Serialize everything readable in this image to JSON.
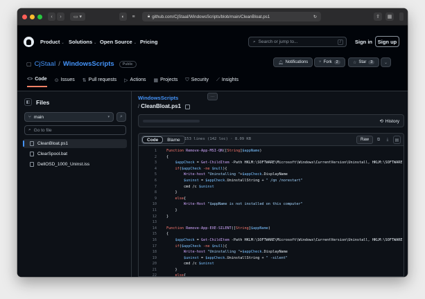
{
  "browser": {
    "url": "github.com/CjStaal/WindowsScripts/blob/main/CleanBloat.ps1"
  },
  "header": {
    "nav": [
      {
        "label": "Product"
      },
      {
        "label": "Solutions"
      },
      {
        "label": "Open Source"
      },
      {
        "label": "Pricing"
      }
    ],
    "search_placeholder": "Search or jump to...",
    "search_key": "/",
    "sign_in": "Sign in",
    "sign_up": "Sign up"
  },
  "repo": {
    "owner": "CjStaal",
    "separator": "/",
    "name": "WindowsScripts",
    "visibility": "Public",
    "notifications_label": "Notifications",
    "fork_label": "Fork",
    "fork_count": "2",
    "star_label": "Star",
    "star_count": "3",
    "tabs": [
      {
        "label": "Code",
        "icon": "<>"
      },
      {
        "label": "Issues",
        "icon": "⊙"
      },
      {
        "label": "Pull requests",
        "icon": "⇅"
      },
      {
        "label": "Actions",
        "icon": "▷"
      },
      {
        "label": "Projects",
        "icon": "▦"
      },
      {
        "label": "Security",
        "icon": "⛉"
      },
      {
        "label": "Insights",
        "icon": "⟋"
      }
    ]
  },
  "sidebar": {
    "title": "Files",
    "branch": "main",
    "goto_placeholder": "Go to file",
    "files": [
      {
        "name": "CleanBloat.ps1",
        "active": true
      },
      {
        "name": "ClearSpool.bat",
        "active": false
      },
      {
        "name": "DellOSD_1000_Uninst.iss",
        "active": false
      }
    ]
  },
  "main": {
    "breadcrumb_repo": "WindowsScripts",
    "breadcrumb_sep": "/",
    "breadcrumb_file": "CleanBloat.ps1",
    "more_label": "···",
    "history_label": "History",
    "code_tab": "Code",
    "blame_tab": "Blame",
    "file_info": "153 lines (142 loc) · 8.09 KB",
    "raw_label": "Raw"
  },
  "code_lines": [
    {
      "n": "1",
      "parts": [
        [
          "kw",
          "Function "
        ],
        [
          "fn",
          "Remove-App-MSI-QN"
        ],
        [
          "pl",
          "(["
        ],
        [
          "kw",
          "String"
        ],
        [
          "pl",
          "]"
        ],
        [
          "var",
          "$appName"
        ],
        [
          "pl",
          ")"
        ]
      ]
    },
    {
      "n": "2",
      "parts": [
        [
          "pl",
          "{"
        ]
      ]
    },
    {
      "n": "3",
      "parts": [
        [
          "pl",
          "    "
        ],
        [
          "var",
          "$appCheck"
        ],
        [
          "pl",
          " = "
        ],
        [
          "fn",
          "Get-ChildItem"
        ],
        [
          "pl",
          " -Path HKLM:\\SOFTWARE\\Microsoft\\Windows\\CurrentVersion\\Uninstall, HKLM:\\SOFTWARE"
        ]
      ]
    },
    {
      "n": "4",
      "parts": [
        [
          "pl",
          "    "
        ],
        [
          "kw",
          "if"
        ],
        [
          "pl",
          "("
        ],
        [
          "var",
          "$appCheck"
        ],
        [
          "kw",
          " -ne "
        ],
        [
          "var",
          "$null"
        ],
        [
          "pl",
          "){"
        ]
      ]
    },
    {
      "n": "5",
      "parts": [
        [
          "pl",
          "        "
        ],
        [
          "fn",
          "Write-host"
        ],
        [
          "str",
          " \"Uninstalling \""
        ],
        [
          "pl",
          "+"
        ],
        [
          "var",
          "$appCheck"
        ],
        [
          "pl",
          ".DisplayName"
        ]
      ]
    },
    {
      "n": "6",
      "parts": [
        [
          "pl",
          "        "
        ],
        [
          "var",
          "$uninst"
        ],
        [
          "pl",
          " = "
        ],
        [
          "var",
          "$appCheck"
        ],
        [
          "pl",
          ".UninstallString + "
        ],
        [
          "str",
          "\" /qn /norestart\""
        ]
      ]
    },
    {
      "n": "7",
      "parts": [
        [
          "pl",
          "        cmd /c "
        ],
        [
          "var",
          "$uninst"
        ]
      ]
    },
    {
      "n": "8",
      "parts": [
        [
          "pl",
          "    }"
        ]
      ]
    },
    {
      "n": "9",
      "parts": [
        [
          "pl",
          "    "
        ],
        [
          "kw",
          "else"
        ],
        [
          "pl",
          "{"
        ]
      ]
    },
    {
      "n": "10",
      "parts": [
        [
          "pl",
          "        "
        ],
        [
          "fn",
          "Write-Host"
        ],
        [
          "str",
          " \"$appName is not installed on this computer\""
        ]
      ]
    },
    {
      "n": "11",
      "parts": [
        [
          "pl",
          "    }"
        ]
      ]
    },
    {
      "n": "12",
      "parts": [
        [
          "pl",
          "}"
        ]
      ]
    },
    {
      "n": "13",
      "parts": [
        [
          "pl",
          ""
        ]
      ]
    },
    {
      "n": "14",
      "parts": [
        [
          "kw",
          "Function "
        ],
        [
          "fn",
          "Remove-App-EXE-SILENT"
        ],
        [
          "pl",
          "(["
        ],
        [
          "kw",
          "String"
        ],
        [
          "pl",
          "]"
        ],
        [
          "var",
          "$appName"
        ],
        [
          "pl",
          ")"
        ]
      ]
    },
    {
      "n": "15",
      "parts": [
        [
          "pl",
          "{"
        ]
      ]
    },
    {
      "n": "16",
      "parts": [
        [
          "pl",
          "    "
        ],
        [
          "var",
          "$appCheck"
        ],
        [
          "pl",
          " = "
        ],
        [
          "fn",
          "Get-ChildItem"
        ],
        [
          "pl",
          " -Path HKLM:\\SOFTWARE\\Microsoft\\Windows\\CurrentVersion\\Uninstall, HKLM:\\SOFTWARE"
        ]
      ]
    },
    {
      "n": "17",
      "parts": [
        [
          "pl",
          "    "
        ],
        [
          "kw",
          "if"
        ],
        [
          "pl",
          "("
        ],
        [
          "var",
          "$appCheck"
        ],
        [
          "kw",
          " -ne "
        ],
        [
          "var",
          "$null"
        ],
        [
          "pl",
          "){"
        ]
      ]
    },
    {
      "n": "18",
      "parts": [
        [
          "pl",
          "        "
        ],
        [
          "fn",
          "Write-host"
        ],
        [
          "str",
          " \"Uninstalling \""
        ],
        [
          "pl",
          "+"
        ],
        [
          "var",
          "$appCheck"
        ],
        [
          "pl",
          ".DisplayName"
        ]
      ]
    },
    {
      "n": "19",
      "parts": [
        [
          "pl",
          "        "
        ],
        [
          "var",
          "$uninst"
        ],
        [
          "pl",
          " = "
        ],
        [
          "var",
          "$appCheck"
        ],
        [
          "pl",
          ".UninstallString + "
        ],
        [
          "str",
          "\" -silent\""
        ]
      ]
    },
    {
      "n": "20",
      "parts": [
        [
          "pl",
          "        cmd /c "
        ],
        [
          "var",
          "$uninst"
        ]
      ]
    },
    {
      "n": "21",
      "parts": [
        [
          "pl",
          "    }"
        ]
      ]
    },
    {
      "n": "22",
      "parts": [
        [
          "pl",
          "    "
        ],
        [
          "kw",
          "else"
        ],
        [
          "pl",
          "{"
        ]
      ]
    }
  ],
  "colors": {
    "accent_link": "#4493f8",
    "active_tab_underline": "#f78166",
    "background": "#0d1117"
  }
}
